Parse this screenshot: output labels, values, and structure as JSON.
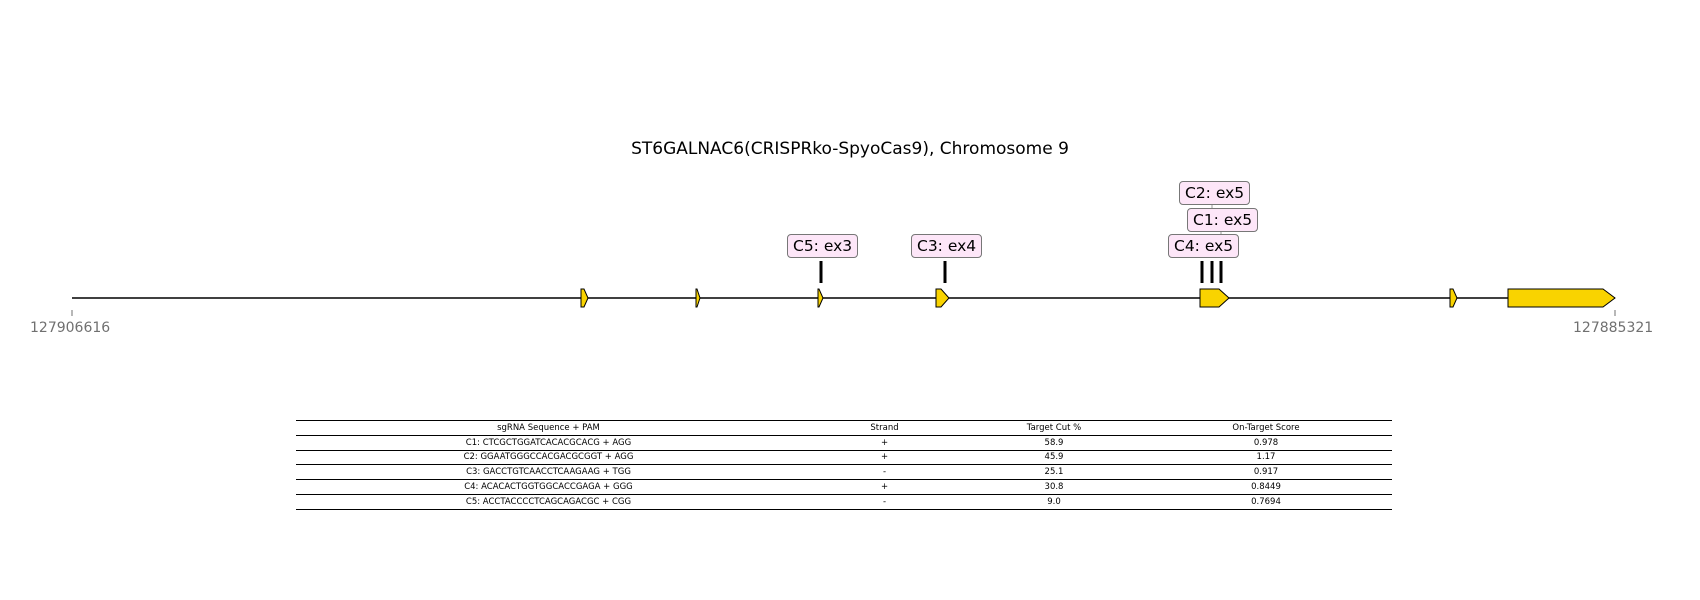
{
  "figure": {
    "title": "ST6GALNAC6(CRISPRko-SpyoCas9), Chromosome 9",
    "coord_start": "127906616",
    "coord_end": "127885321"
  },
  "colors": {
    "exon_fill": "#f9d300",
    "label_bg": "#fde6f8",
    "label_border": "#777777",
    "axis_text": "#707070"
  },
  "guide_labels": [
    "C5: ex3",
    "C3: ex4",
    "C4: ex5",
    "C1: ex5",
    "C2: ex5"
  ],
  "table": {
    "headers": [
      "sgRNA Sequence + PAM",
      "Strand",
      "Target Cut %",
      "On-Target Score"
    ],
    "rows": [
      [
        "C1: CTCGCTGGATCACACGCACG + AGG",
        "+",
        "58.9",
        "0.978"
      ],
      [
        "C2: GGAATGGGCCACGACGCGGT + AGG",
        "+",
        "45.9",
        "1.17"
      ],
      [
        "C3: GACCTGTCAACCTCAAGAAG + TGG",
        "-",
        "25.1",
        "0.917"
      ],
      [
        "C4: ACACACTGGTGGCACCGAGA + GGG",
        "+",
        "30.8",
        "0.8449"
      ],
      [
        "C5: ACCTACCCCTCAGCAGACGC + CGG",
        "-",
        "9.0",
        "0.7694"
      ]
    ]
  }
}
